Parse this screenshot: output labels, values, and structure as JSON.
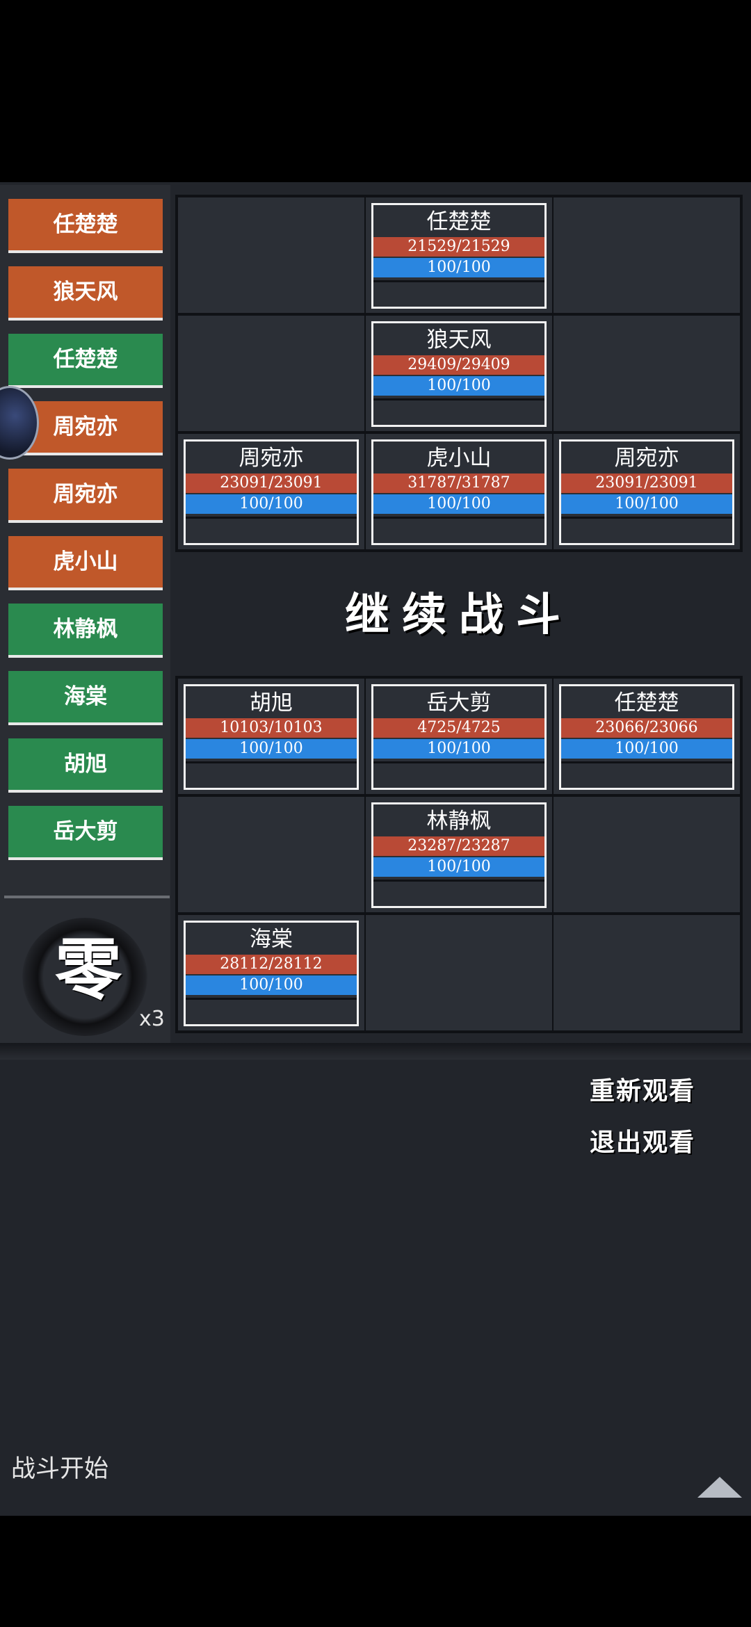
{
  "turn_order": [
    {
      "name": "任楚楚",
      "side": "enemy",
      "color": "#c0582a"
    },
    {
      "name": "狼天风",
      "side": "enemy",
      "color": "#c0582a"
    },
    {
      "name": "任楚楚",
      "side": "ally",
      "color": "#2a8a4f"
    },
    {
      "name": "周宛亦",
      "side": "enemy",
      "color": "#c0582a"
    },
    {
      "name": "周宛亦",
      "side": "enemy",
      "color": "#c0582a"
    },
    {
      "name": "虎小山",
      "side": "enemy",
      "color": "#c0582a"
    },
    {
      "name": "林静枫",
      "side": "ally",
      "color": "#2a8a4f"
    },
    {
      "name": "海棠",
      "side": "ally",
      "color": "#2a8a4f"
    },
    {
      "name": "胡旭",
      "side": "ally",
      "color": "#2a8a4f"
    },
    {
      "name": "岳大剪",
      "side": "ally",
      "color": "#2a8a4f"
    }
  ],
  "speed": {
    "glyph": "零",
    "multiplier": "x3"
  },
  "enemy_team": {
    "r1c2": {
      "name": "任楚楚",
      "hp": "21529/21529",
      "mp": "100/100"
    },
    "r2c2": {
      "name": "狼天风",
      "hp": "29409/29409",
      "mp": "100/100"
    },
    "r3c1": {
      "name": "周宛亦",
      "hp": "23091/23091",
      "mp": "100/100"
    },
    "r3c2": {
      "name": "虎小山",
      "hp": "31787/31787",
      "mp": "100/100"
    },
    "r3c3": {
      "name": "周宛亦",
      "hp": "23091/23091",
      "mp": "100/100"
    }
  },
  "continue_label": "继续战斗",
  "ally_team": {
    "r1c1": {
      "name": "胡旭",
      "hp": "10103/10103",
      "mp": "100/100"
    },
    "r1c2": {
      "name": "岳大剪",
      "hp": "4725/4725",
      "mp": "100/100"
    },
    "r1c3": {
      "name": "任楚楚",
      "hp": "23066/23066",
      "mp": "100/100"
    },
    "r2c2": {
      "name": "林静枫",
      "hp": "23287/23287",
      "mp": "100/100"
    },
    "r3c1": {
      "name": "海棠",
      "hp": "28112/28112",
      "mp": "100/100"
    }
  },
  "actions": {
    "replay": "重新观看",
    "exit": "退出观看"
  },
  "log_text": "战斗开始",
  "colors": {
    "hp_bar": "#b94a36",
    "mp_bar": "#2a86e0",
    "enemy_turn": "#c0582a",
    "ally_turn": "#2a8a4f"
  },
  "icons": {
    "scroll_up": "triangle-up-icon",
    "speed_dial": "brush-ring-icon"
  }
}
